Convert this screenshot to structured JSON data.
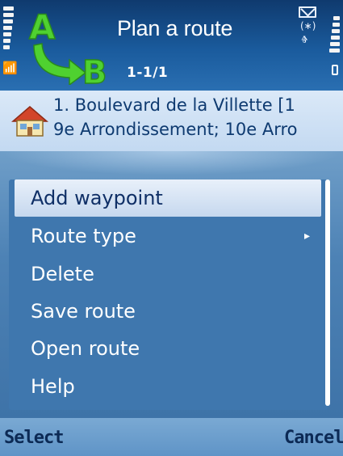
{
  "header": {
    "title": "Plan a route",
    "subtitle": "1-1/1",
    "logo_letter_a": "A",
    "logo_letter_b": "B"
  },
  "status_icons": {
    "signal": "signal-strength-icon",
    "antenna": "antenna-icon",
    "battery": "battery-icon",
    "message": "envelope-icon",
    "bluetooth": "bluetooth-icon",
    "usb": "usb-icon"
  },
  "waypoint": {
    "icon": "house-icon",
    "line1": "1. Boulevard de la Villette [1",
    "line2": "9e Arrondissement; 10e Arro"
  },
  "menu": {
    "items": [
      {
        "label": "Add waypoint",
        "highlighted": true
      },
      {
        "label": "Route type",
        "has_submenu": true
      },
      {
        "label": "Delete"
      },
      {
        "label": "Save route"
      },
      {
        "label": "Open route"
      },
      {
        "label": "Help"
      }
    ]
  },
  "softkeys": {
    "left": "Select",
    "right": "Cancel"
  },
  "colors": {
    "title_bar": "#1a5b9d",
    "panel": "#c3d9f1",
    "menu_background": "#3f77ae",
    "highlight": "#c6d8ee",
    "logo_green": "#4fd130"
  }
}
